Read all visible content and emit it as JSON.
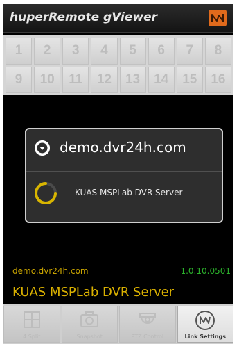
{
  "app": {
    "title": "huperRemote gViewer",
    "logo_icon": "waveform-logo-icon",
    "accent_color": "#e06a1c"
  },
  "channels": [
    "1",
    "2",
    "3",
    "4",
    "5",
    "6",
    "7",
    "8",
    "9",
    "10",
    "11",
    "12",
    "13",
    "14",
    "15",
    "16"
  ],
  "dialog": {
    "title": "demo.dvr24h.com",
    "message": "KUAS MSPLab DVR Server",
    "icon": "chevron-down-circle-icon",
    "spinner": "loading-spinner-icon"
  },
  "status": {
    "host": "demo.dvr24h.com",
    "version": "1.0.10.0501",
    "server_name": "KUAS MSPLab DVR Server",
    "host_color": "#c9a400",
    "version_color": "#2bb02b"
  },
  "bottom_bar": {
    "buttons": [
      {
        "label": "4 Split",
        "icon": "split-grid-icon",
        "active": false
      },
      {
        "label": "Snapshot",
        "icon": "camera-icon",
        "active": false
      },
      {
        "label": "PTZ Control",
        "icon": "dome-camera-icon",
        "active": false
      },
      {
        "label": "Link Settings",
        "icon": "waveform-circle-icon",
        "active": true
      }
    ]
  }
}
